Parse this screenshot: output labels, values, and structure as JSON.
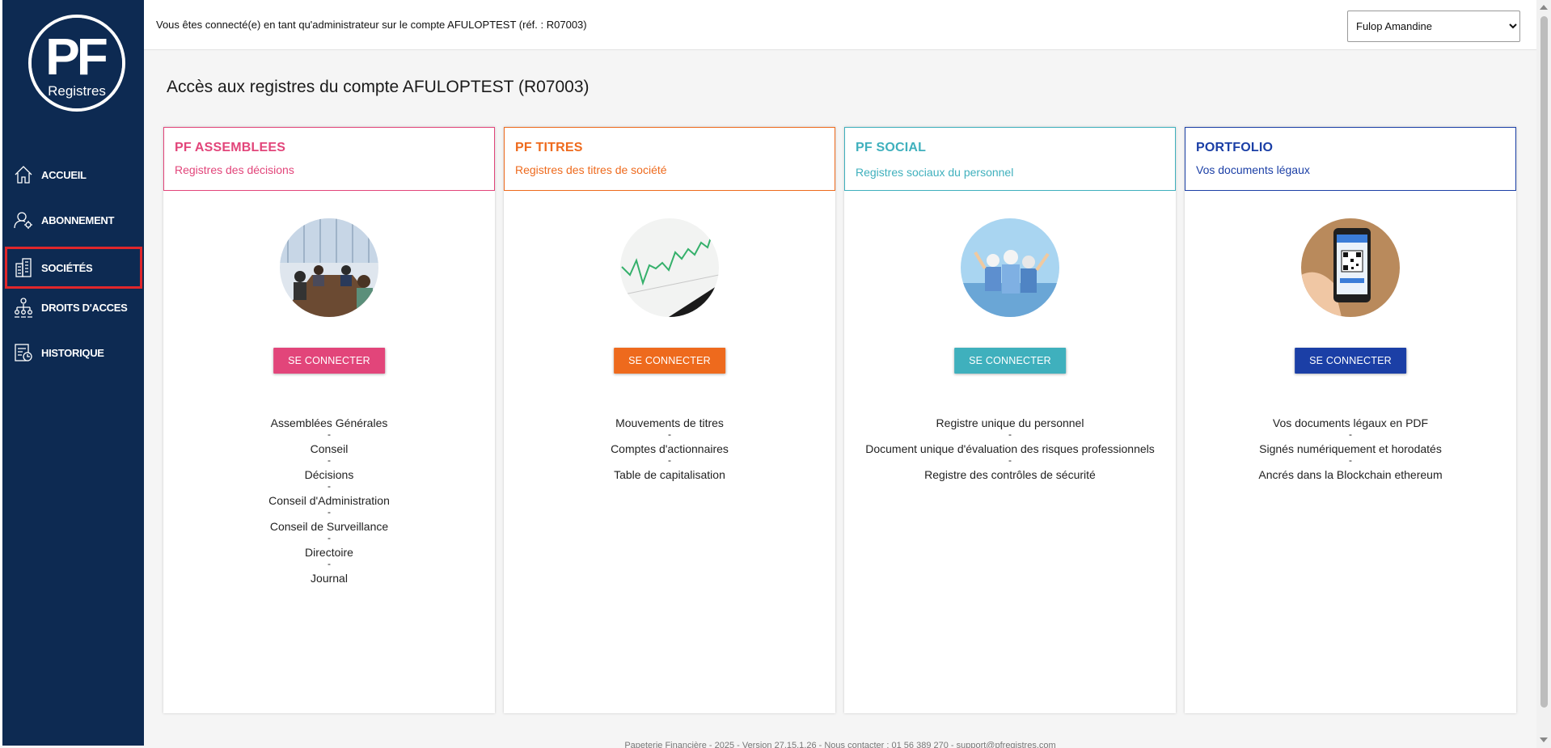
{
  "logo": {
    "big": "PF",
    "small": "Registres"
  },
  "sidebar": {
    "items": [
      {
        "label": "ACCUEIL",
        "icon": "house-icon"
      },
      {
        "label": "ABONNEMENT",
        "icon": "user-gear-icon"
      },
      {
        "label": "SOCIÉTÉS",
        "icon": "buildings-icon",
        "highlighted": true
      },
      {
        "label": "DROITS D'ACCES",
        "icon": "org-chart-icon"
      },
      {
        "label": "HISTORIQUE",
        "icon": "history-icon"
      }
    ]
  },
  "topbar": {
    "message": "Vous êtes connecté(e) en tant qu'administrateur sur le compte AFULOPTEST (réf. : R07003)",
    "user_select": {
      "selected": "Fulop Amandine"
    }
  },
  "page": {
    "title": "Accès aux registres du compte AFULOPTEST (R07003)"
  },
  "cards": [
    {
      "title": "PF ASSEMBLEES",
      "subtitle": "Registres des décisions",
      "color": "#e2457a",
      "button": "SE CONNECTER",
      "features": [
        "Assemblées Générales",
        "Conseil",
        "Décisions",
        "Conseil d'Administration",
        "Conseil de Surveillance",
        "Directoire",
        "Journal"
      ]
    },
    {
      "title": "PF TITRES",
      "subtitle": "Registres des titres de société",
      "color": "#ee6a1d",
      "button": "SE CONNECTER",
      "features": [
        "Mouvements de titres",
        "Comptes d'actionnaires",
        "Table de capitalisation"
      ]
    },
    {
      "title": "PF SOCIAL",
      "subtitle": "Registres sociaux du personnel",
      "color": "#3fb0bd",
      "button": "SE CONNECTER",
      "features": [
        "Registre unique du personnel",
        "Document unique d'évaluation des risques professionnels",
        "Registre des contrôles de sécurité"
      ]
    },
    {
      "title": "PORTFOLIO",
      "subtitle": "Vos documents légaux",
      "color": "#1b3fa6",
      "button": "SE CONNECTER",
      "features": [
        "Vos documents légaux en PDF",
        "Signés numériquement et horodatés",
        "Ancrés dans la Blockchain ethereum"
      ]
    }
  ],
  "footer": {
    "text": "Papeterie Financière - 2025 - Version 27.15.1.26 - Nous contacter : 01 56 389 270 - support@pfregistres.com"
  },
  "separator": "-"
}
